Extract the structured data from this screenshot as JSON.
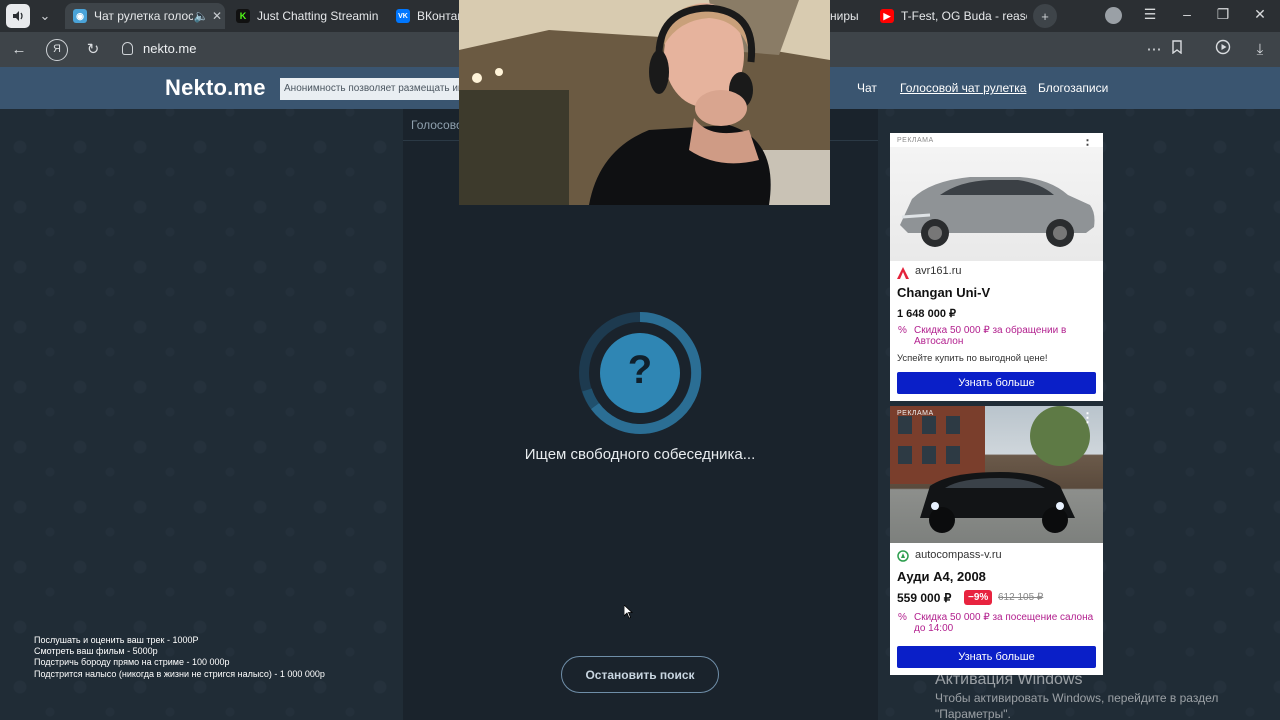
{
  "browser": {
    "tabs": [
      {
        "label": "Чат рулетка голосо",
        "active": true,
        "favicon_color": "#4aa3d8"
      },
      {
        "label": "Just Chatting Streaming -",
        "active": false,
        "favicon_color": "#53fc18",
        "favicon_text": "K"
      },
      {
        "label": "ВКонтакт",
        "active": false,
        "favicon_color": "#0077ff",
        "favicon_text": "VK"
      },
      {
        "label": "ниры",
        "active": false
      },
      {
        "label": "T-Fest, OG Buda - reason",
        "active": false,
        "favicon_color": "#ff0000"
      }
    ],
    "url": "nekto.me",
    "icons": {
      "back": "back-arrow-icon",
      "yandex": "yandex-icon",
      "reload": "reload-icon",
      "lock": "lock-icon",
      "more": "more-dots-icon",
      "bookmark": "bookmark-icon",
      "player": "player-icon",
      "download": "download-icon"
    }
  },
  "site": {
    "logo": "Nekto.me",
    "notice": "Анонимность позволяет размещать инф",
    "nav": [
      {
        "label": "Чат",
        "underlined": false
      },
      {
        "label": "Голосовой чат рулетка",
        "underlined": true
      },
      {
        "label": "Блогозаписи",
        "underlined": false
      }
    ],
    "breadcrumb": "Голосово"
  },
  "search": {
    "status": "Ищем свободного собеседника...",
    "stop_label": "Остановить поиск",
    "spinner_symbol": "?"
  },
  "donations": [
    "Послушать и оценить ваш трек - 1000Р",
    "Смотреть ваш фильм - 5000р",
    "Подстричь бороду прямо на стриме - 100 000р",
    "Подстрится налысо (никогда в жизни не стригся налысо) - 1 000 000р"
  ],
  "ads": [
    {
      "label": "РЕКЛАМА",
      "domain": "avr161.ru",
      "title": "Changan Uni-V",
      "price": "1 648 000 ₽",
      "promo": "Скидка 50 000 ₽ за обращении в Автосалон",
      "note": "Успейте купить по выгодной цене!",
      "button": "Узнать больше"
    },
    {
      "label": "РЕКЛАМА",
      "domain": "autocompass-v.ru",
      "title": "Ауди А4, 2008",
      "price": "559 000 ₽",
      "discount": "−9%",
      "old_price": "612 105 ₽",
      "promo": "Скидка 50 000 ₽ за посещение салона до 14:00",
      "button": "Узнать больше"
    }
  ],
  "watermark": {
    "title": "Активация Windows",
    "subtitle": "Чтобы активировать Windows, перейдите в раздел",
    "subtitle2": "\"Параметры\"."
  },
  "colors": {
    "header": "#3a5570",
    "accent_blue": "#0a1fc8",
    "promo": "#b21f8e",
    "spinner": "#2f86b4"
  }
}
